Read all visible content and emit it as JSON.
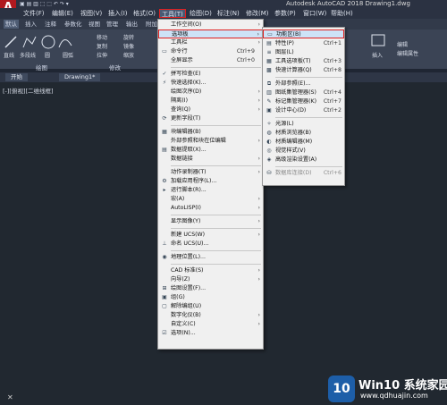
{
  "titlebar": {
    "logo": "A",
    "title": "Autodesk AutoCAD 2018    Drawing1.dwg",
    "qat": "▣ ▤ ▥ ⬚ ⬚ ↶ ↷ ▾"
  },
  "menubar": {
    "items": [
      "文件(F)",
      "编辑(E)",
      "视图(V)",
      "插入(I)",
      "格式(O)",
      "工具(T)",
      "绘图(D)",
      "标注(N)",
      "修改(M)",
      "参数(P)",
      "窗口(W)",
      "帮助(H)"
    ]
  },
  "ribbon_tabs": [
    "默认",
    "插入",
    "注释",
    "参数化",
    "视图",
    "管理",
    "输出",
    "附加"
  ],
  "ribbon": {
    "left": [
      "直线",
      "多段线",
      "圆",
      "圆弧"
    ],
    "modify": [
      "移动",
      "复制",
      "拉伸",
      "旋转",
      "镜像",
      "缩放"
    ],
    "right": [
      "插入",
      "编辑",
      "编辑属性"
    ],
    "panels": [
      "绘图",
      "修改"
    ]
  },
  "doc_tabs": [
    "开始",
    "Drawing1*"
  ],
  "viewport_label": "[-][俯视][二维线框]",
  "tools_menu": [
    {
      "label": "工作空间(O)",
      "arrow": "›"
    },
    {
      "label": "选项板",
      "arrow": "›",
      "highlight": true
    },
    {
      "label": "工具栏",
      "arrow": "›"
    },
    {
      "label": "命令行",
      "shortcut": "Ctrl+9"
    },
    {
      "label": "全屏显示",
      "shortcut": "Ctrl+0"
    },
    {
      "sep": true
    },
    {
      "label": "拼写检查(E)"
    },
    {
      "label": "快速选择(K)..."
    },
    {
      "label": "绘图次序(D)",
      "arrow": "›"
    },
    {
      "label": "隔离(I)",
      "arrow": "›"
    },
    {
      "label": "查询(Q)",
      "arrow": "›"
    },
    {
      "label": "更新字段(T)"
    },
    {
      "sep": true
    },
    {
      "label": "块编辑器(B)"
    },
    {
      "label": "外部参照和块在位编辑",
      "arrow": "›"
    },
    {
      "label": "数据提取(X)..."
    },
    {
      "label": "数据链接",
      "arrow": "›"
    },
    {
      "sep": true
    },
    {
      "label": "动作录制器(T)",
      "arrow": "›"
    },
    {
      "label": "加载应用程序(L)..."
    },
    {
      "label": "运行脚本(R)..."
    },
    {
      "label": "宏(A)",
      "arrow": "›"
    },
    {
      "label": "AutoLISP(I)",
      "arrow": "›"
    },
    {
      "sep": true
    },
    {
      "label": "显示图像(Y)",
      "arrow": "›"
    },
    {
      "sep": true
    },
    {
      "label": "新建 UCS(W)",
      "arrow": "›"
    },
    {
      "label": "命名 UCS(U)..."
    },
    {
      "sep": true
    },
    {
      "label": "地理位置(L)..."
    },
    {
      "sep": true
    },
    {
      "label": "CAD 标准(S)",
      "arrow": "›"
    },
    {
      "label": "向导(Z)",
      "arrow": "›"
    },
    {
      "label": "绘图设置(F)..."
    },
    {
      "label": "组(G)"
    },
    {
      "label": "解除编组(U)"
    },
    {
      "label": "数字化仪(B)",
      "arrow": "›"
    },
    {
      "label": "自定义(C)",
      "arrow": "›"
    },
    {
      "label": "选项(N)..."
    }
  ],
  "palettes_menu": [
    {
      "label": "功能区(B)",
      "highlight": true
    },
    {
      "label": "特性(P)",
      "shortcut": "Ctrl+1"
    },
    {
      "label": "图层(L)"
    },
    {
      "label": "工具选项板(T)",
      "shortcut": "Ctrl+3"
    },
    {
      "label": "快速计算器(Q)",
      "shortcut": "Ctrl+8"
    },
    {
      "sep": true
    },
    {
      "label": "外部参照(E)..."
    },
    {
      "label": "图纸集管理器(S)",
      "shortcut": "Ctrl+4"
    },
    {
      "label": "标记集管理器(K)",
      "shortcut": "Ctrl+7"
    },
    {
      "label": "设计中心(D)",
      "shortcut": "Ctrl+2"
    },
    {
      "sep": true
    },
    {
      "label": "光源(L)"
    },
    {
      "label": "材质浏览器(B)"
    },
    {
      "label": "材质编辑器(M)"
    },
    {
      "label": "视觉样式(V)"
    },
    {
      "label": "高级渲染设置(A)"
    },
    {
      "sep": true
    },
    {
      "label": "数据库连接(D)",
      "shortcut": "Ctrl+6",
      "disabled": true
    }
  ],
  "watermark": {
    "logo": "10",
    "title": "Win10 系统家园",
    "url": "www.qdhuajin.com"
  }
}
